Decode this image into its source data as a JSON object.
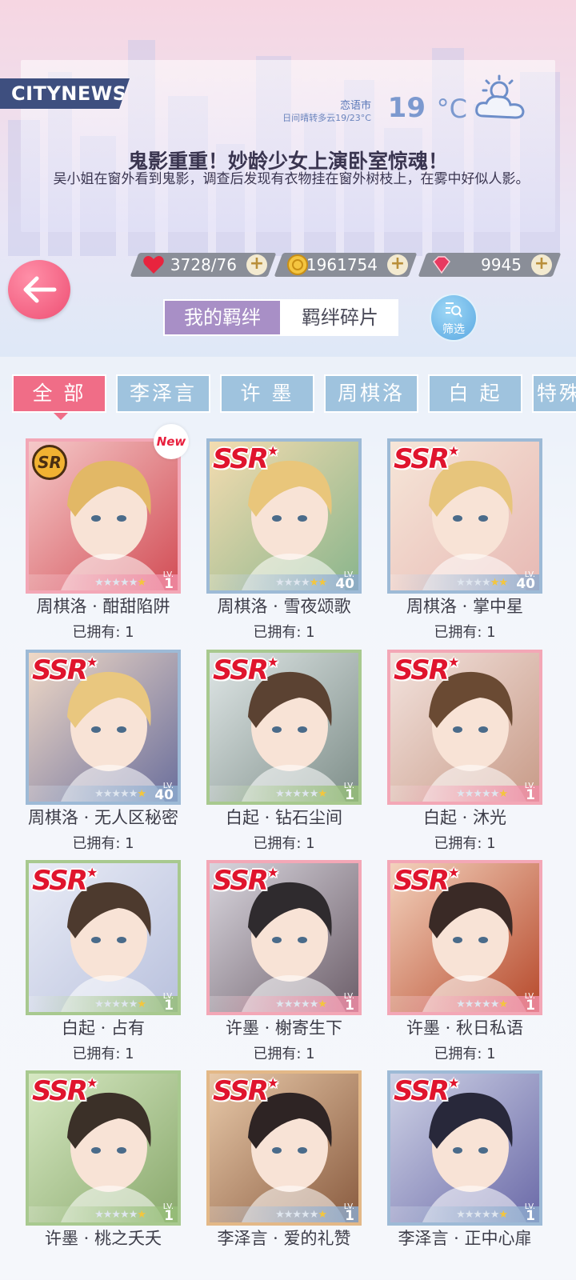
{
  "news": {
    "brand": "CITYNEWS",
    "city": "恋语市",
    "forecast": "日间晴转多云19/23°C",
    "temperature": "19",
    "unit": "°C",
    "headline": "鬼影重重！妙龄少女上演卧室惊魂！",
    "summary": "吴小姐在窗外看到鬼影，调查后发现有衣物挂在窗外树枝上，在雾中好似人影。",
    "weather_icon": "sun-cloud-icon"
  },
  "currencies": [
    {
      "icon": "heart-icon",
      "value": "3728/76"
    },
    {
      "icon": "gold-coin-icon",
      "value": "1961754"
    },
    {
      "icon": "diamond-icon",
      "value": "9945"
    }
  ],
  "segments": {
    "active": "我的羁绊",
    "other": "羁绊碎片"
  },
  "filter_label": "筛选",
  "char_tabs": [
    "全 部",
    "李泽言",
    "许 墨",
    "周棋洛",
    "白 起",
    "特殊"
  ],
  "colors": {
    "accent": "#f06d87",
    "tab": "#9fc3de",
    "segment_active": "#a88fc6",
    "rarity_red": "#e0142d"
  },
  "cards": [
    {
      "name": "周棋洛 · 酣甜陷阱",
      "owned": "已拥有: 1",
      "rarity": "SR",
      "level": "1",
      "stars": 1,
      "is_new": true,
      "new_label": "New"
    },
    {
      "name": "周棋洛 · 雪夜颂歌",
      "owned": "已拥有: 1",
      "rarity": "SSR",
      "level": "40",
      "stars": 2
    },
    {
      "name": "周棋洛 · 掌中星",
      "owned": "已拥有: 1",
      "rarity": "SSR",
      "level": "40",
      "stars": 2
    },
    {
      "name": "周棋洛 · 无人区秘密",
      "owned": "已拥有: 1",
      "rarity": "SSR",
      "level": "40",
      "stars": 1
    },
    {
      "name": "白起 · 钻石尘间",
      "owned": "已拥有: 1",
      "rarity": "SSR",
      "level": "1",
      "stars": 1
    },
    {
      "name": "白起 · 沐光",
      "owned": "已拥有: 1",
      "rarity": "SSR",
      "level": "1",
      "stars": 1
    },
    {
      "name": "白起 · 占有",
      "owned": "已拥有: 1",
      "rarity": "SSR",
      "level": "1",
      "stars": 1
    },
    {
      "name": "许墨 · 榭寄生下",
      "owned": "已拥有: 1",
      "rarity": "SSR",
      "level": "1",
      "stars": 1
    },
    {
      "name": "许墨 · 秋日私语",
      "owned": "已拥有: 1",
      "rarity": "SSR",
      "level": "1",
      "stars": 1
    },
    {
      "name": "许墨 · 桃之夭夭",
      "owned": "",
      "rarity": "SSR",
      "level": "1",
      "stars": 1
    },
    {
      "name": "李泽言 · 爱的礼赞",
      "owned": "",
      "rarity": "SSR",
      "level": "1",
      "stars": 1
    },
    {
      "name": "李泽言 · 正中心扉",
      "owned": "",
      "rarity": "SSR",
      "level": "1",
      "stars": 1
    }
  ],
  "lv_label": "LV."
}
